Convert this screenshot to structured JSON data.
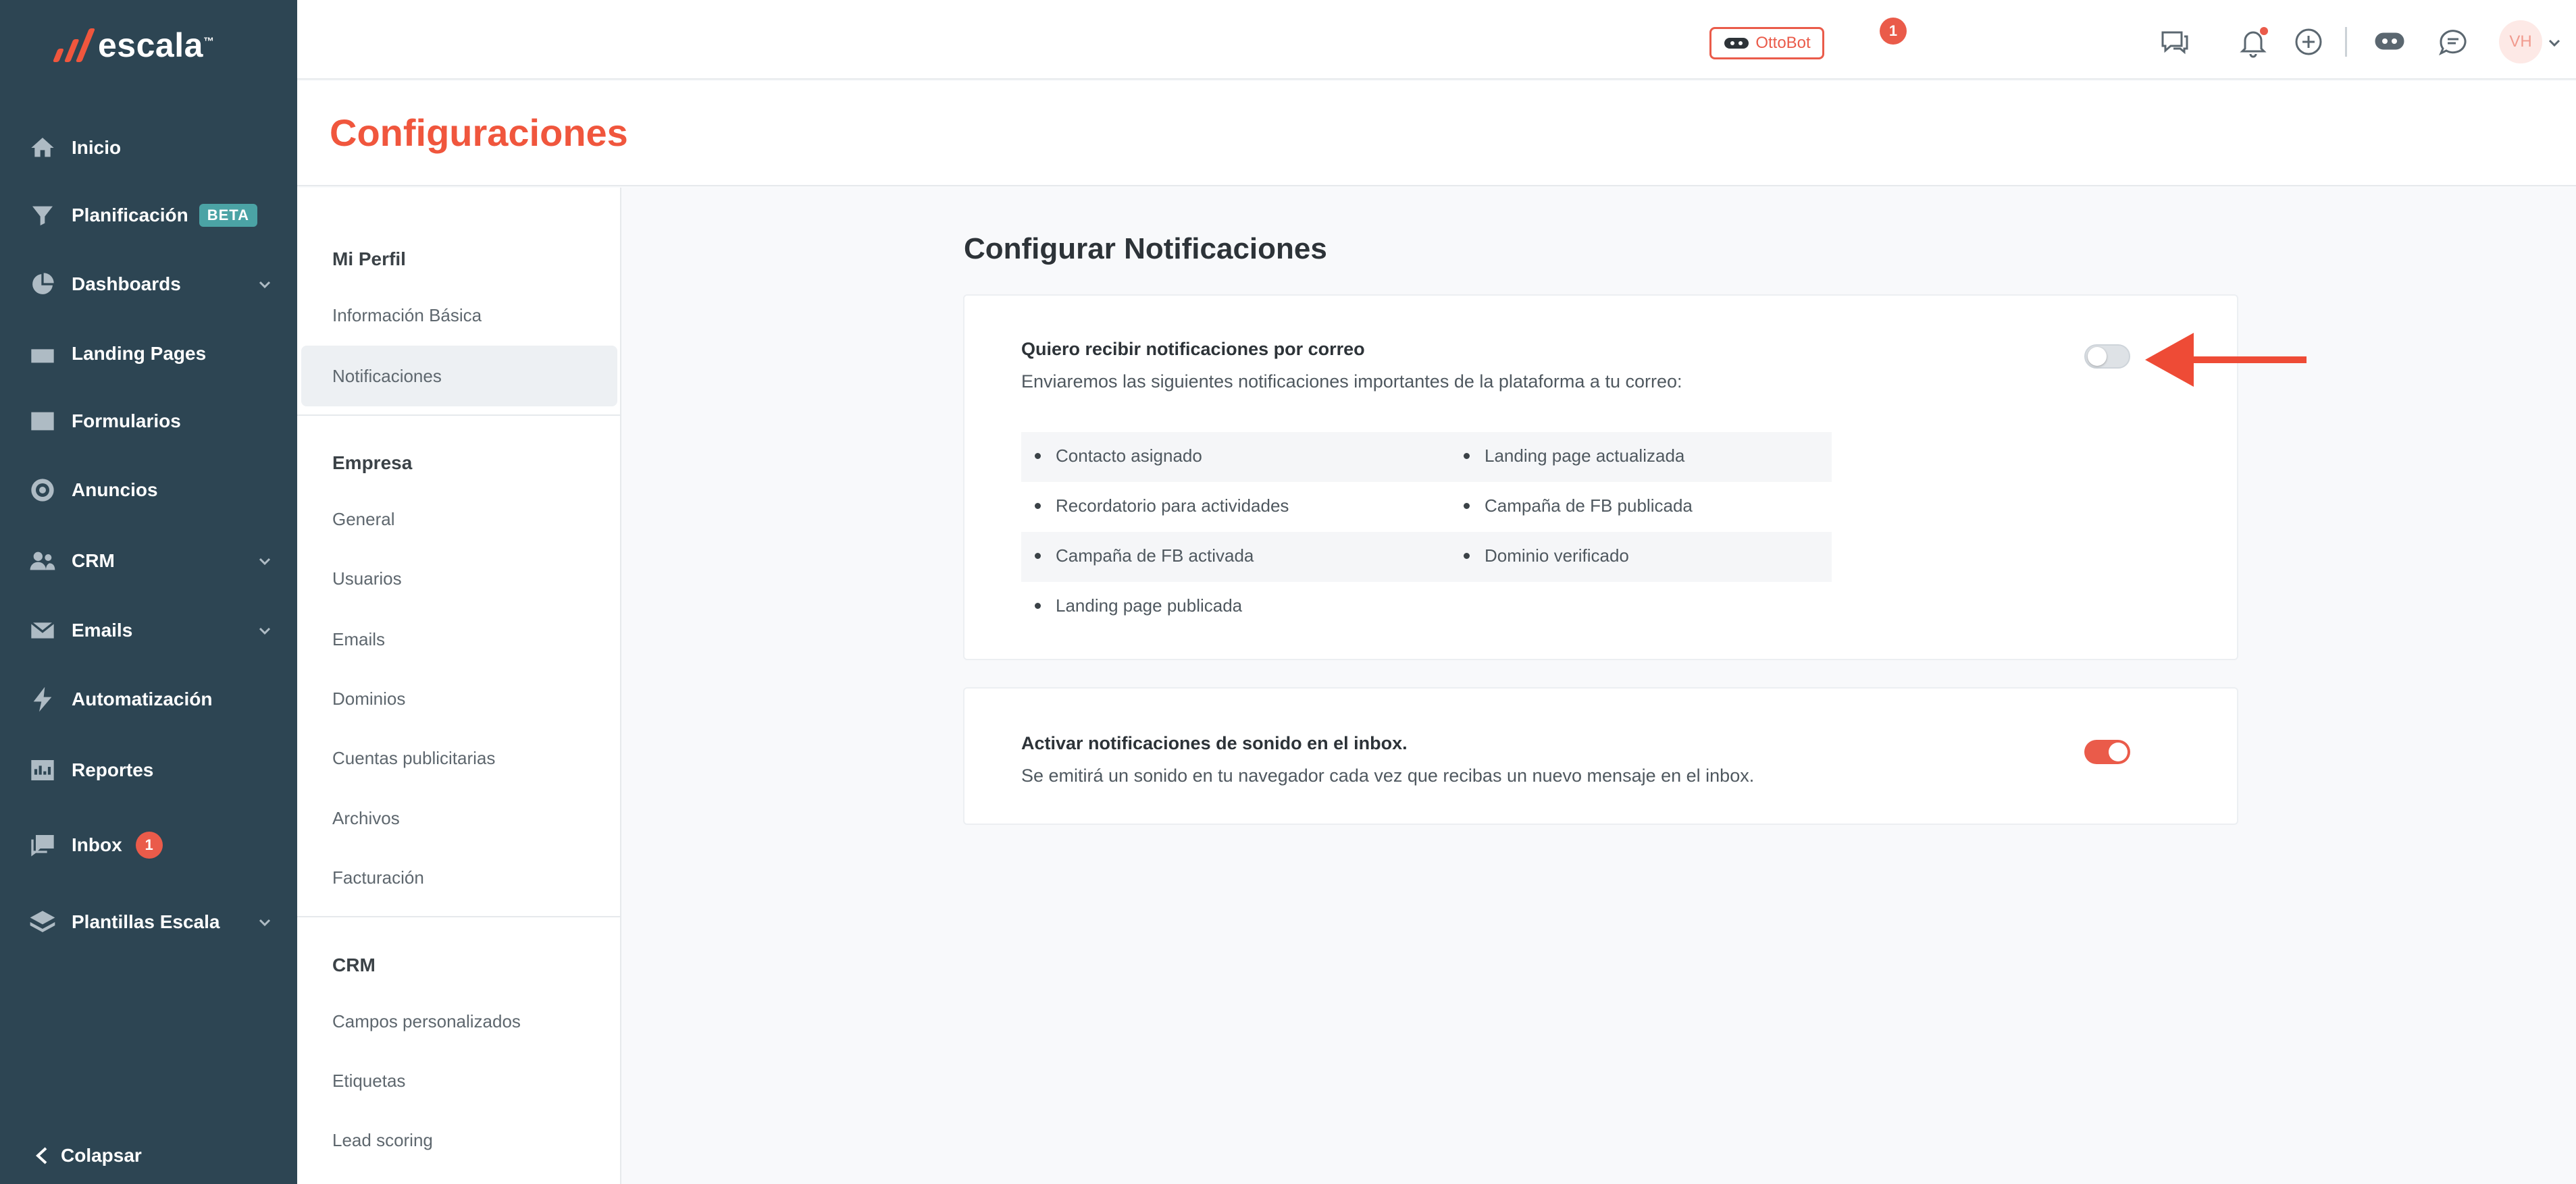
{
  "brand": {
    "name": "escala",
    "tm": "™"
  },
  "sidebar": {
    "items": [
      {
        "label": "Inicio",
        "icon": "home-icon"
      },
      {
        "label": "Planificación",
        "icon": "filter-icon",
        "badge": "BETA"
      },
      {
        "label": "Dashboards",
        "icon": "pie-chart-icon",
        "expandable": true
      },
      {
        "label": "Landing Pages",
        "icon": "browser-icon"
      },
      {
        "label": "Formularios",
        "icon": "form-icon"
      },
      {
        "label": "Anuncios",
        "icon": "target-icon"
      },
      {
        "label": "CRM",
        "icon": "users-icon",
        "expandable": true
      },
      {
        "label": "Emails",
        "icon": "envelope-icon",
        "expandable": true
      },
      {
        "label": "Automatización",
        "icon": "bolt-icon"
      },
      {
        "label": "Reportes",
        "icon": "report-icon"
      },
      {
        "label": "Inbox",
        "icon": "chat-icon",
        "count": "1"
      },
      {
        "label": "Plantillas Escala",
        "icon": "layers-icon",
        "expandable": true
      }
    ],
    "collapse_label": "Colapsar"
  },
  "topbar": {
    "ottobot_label": "OttoBot",
    "messages_badge": "1",
    "avatar_initials": "VH"
  },
  "page": {
    "title": "Configuraciones"
  },
  "subnav": {
    "sections": [
      {
        "heading": "Mi Perfil",
        "items": [
          "Información Básica",
          "Notificaciones"
        ]
      },
      {
        "heading": "Empresa",
        "items": [
          "General",
          "Usuarios",
          "Emails",
          "Dominios",
          "Cuentas publicitarias",
          "Archivos",
          "Facturación"
        ]
      },
      {
        "heading": "CRM",
        "items": [
          "Campos personalizados",
          "Etiquetas",
          "Lead scoring"
        ]
      }
    ],
    "active_item": "Notificaciones"
  },
  "main": {
    "section_title": "Configurar Notificaciones",
    "email_card": {
      "title": "Quiero recibir notificaciones por correo",
      "description": "Enviaremos las siguientes notificaciones importantes de la plataforma a tu correo:",
      "toggle_on": false,
      "notifications_left": [
        "Contacto asignado",
        "Recordatorio para actividades",
        "Campaña de FB activada",
        "Landing page publicada"
      ],
      "notifications_right": [
        "Landing page actualizada",
        "Campaña de FB publicada",
        "Dominio verificado"
      ]
    },
    "sound_card": {
      "title": "Activar notificaciones de sonido en el inbox.",
      "description": "Se emitirá un sonido en tu navegador cada vez que recibas un nuevo mensaje en el inbox.",
      "toggle_on": true
    }
  },
  "colors": {
    "sidebar_bg": "#2d4553",
    "accent": "#f0563d",
    "toggle_on": "#ea5b4a",
    "annotation_arrow": "#ee4b36"
  }
}
